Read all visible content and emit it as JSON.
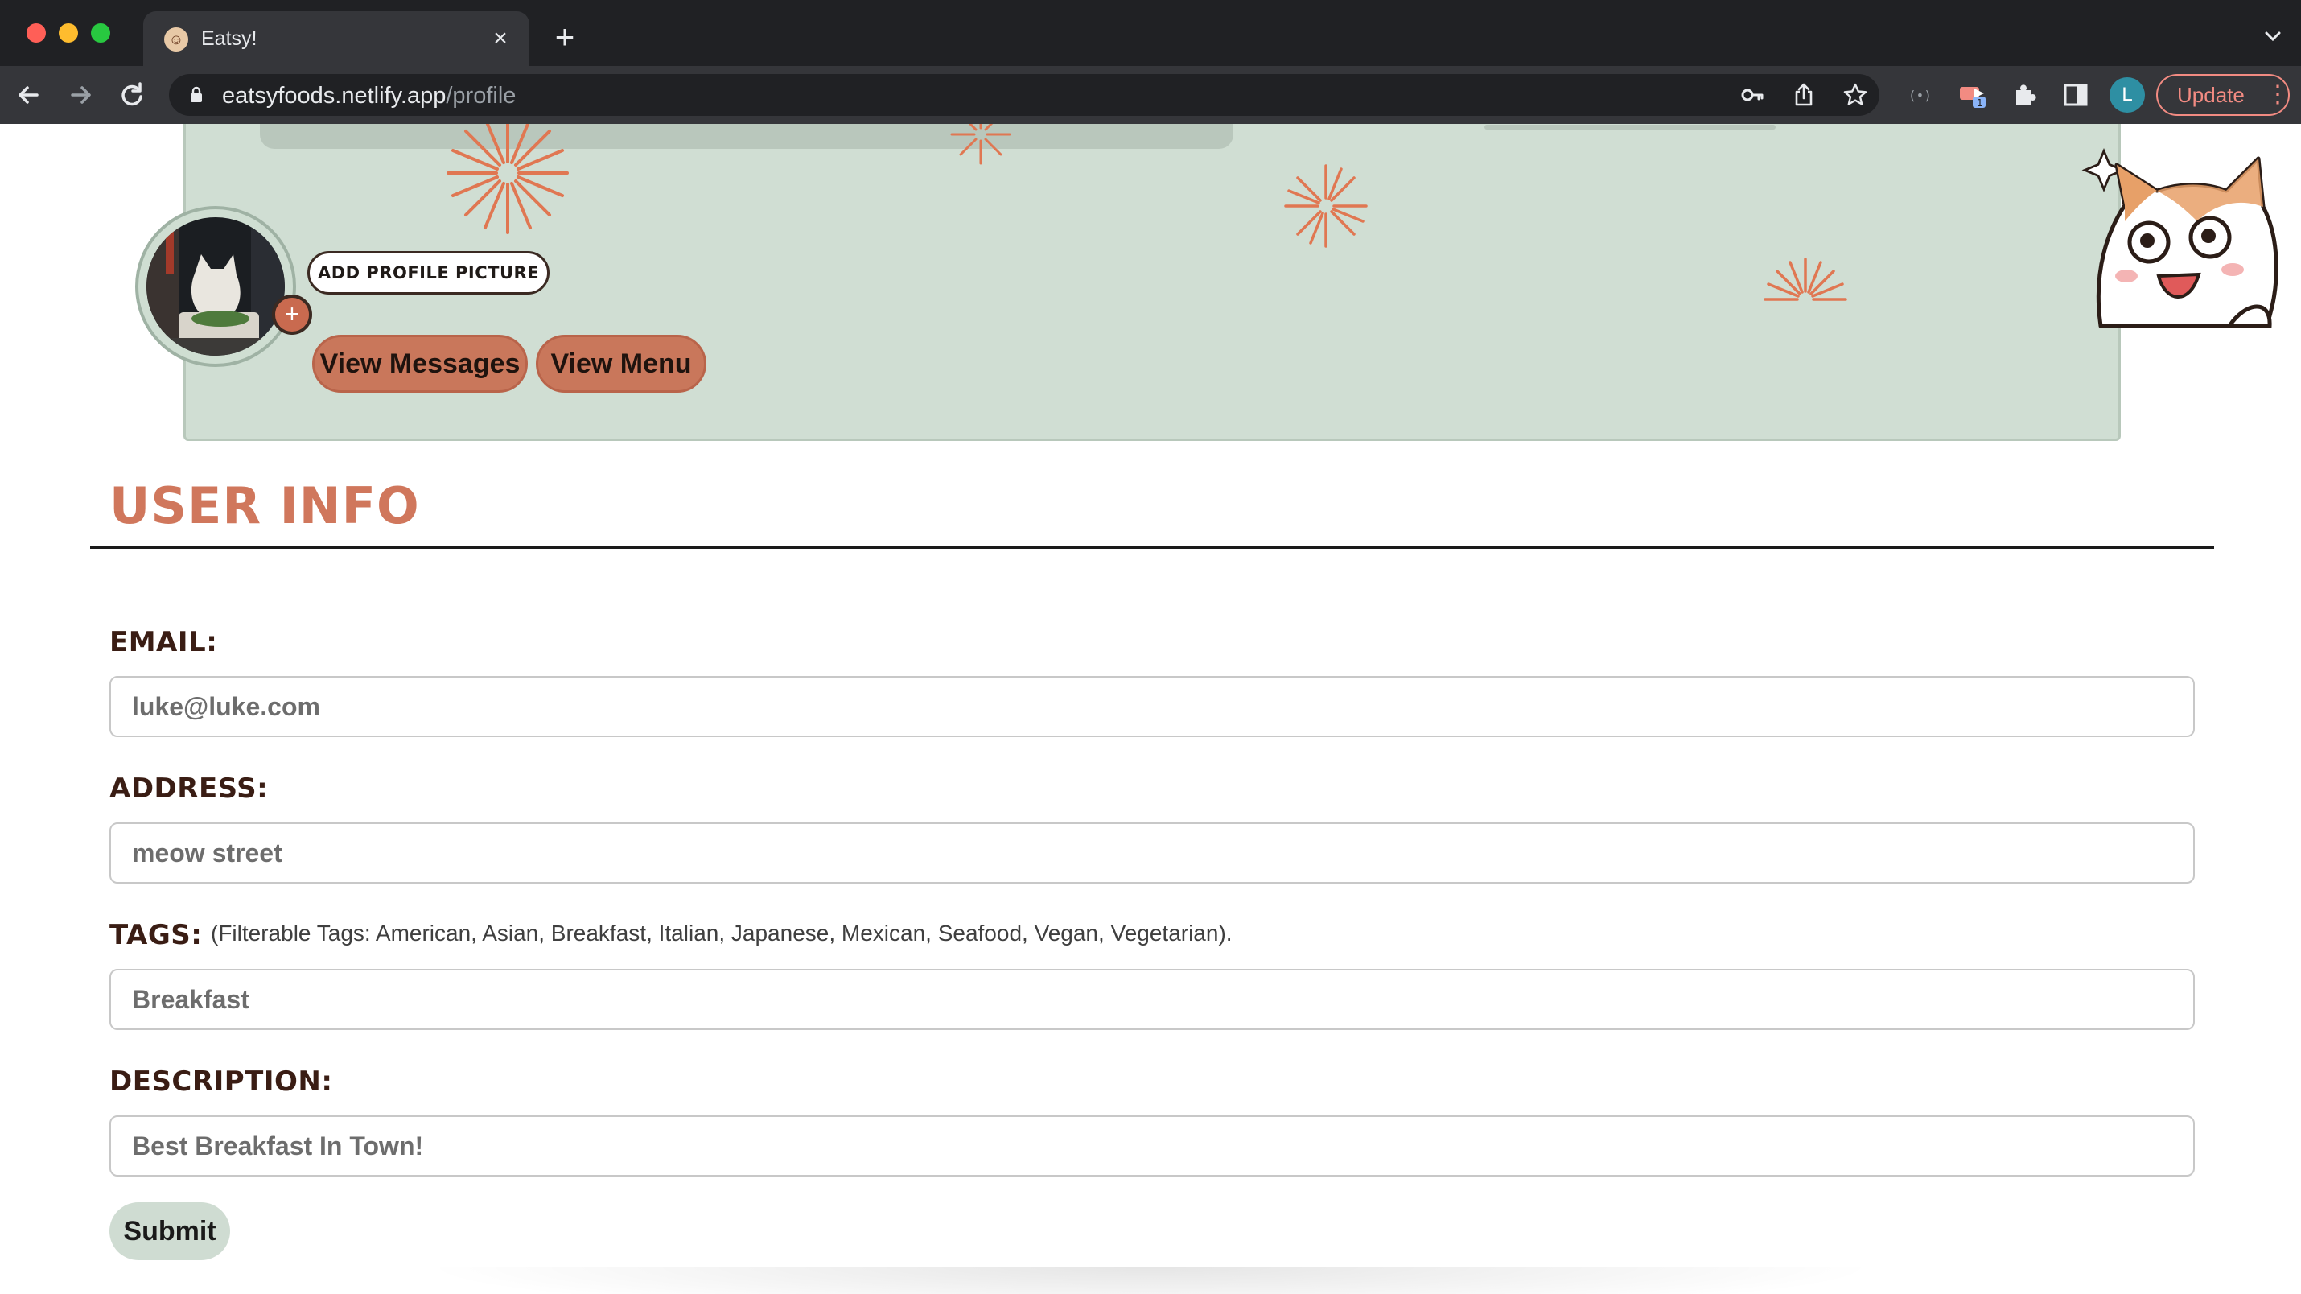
{
  "browser": {
    "tab_title": "Eatsy!",
    "tab_close_glyph": "×",
    "new_tab_glyph": "+",
    "url_host": "eatsyfoods.netlify.app",
    "url_path": "/profile",
    "profile_initial": "L",
    "update_label": "Update",
    "extension_badge": "1",
    "icons": [
      "back-icon",
      "forward-icon",
      "reload-icon",
      "lock-icon",
      "key-icon",
      "share-icon",
      "star-icon",
      "media-icon",
      "cast-extension-icon",
      "puzzle-icon",
      "sidebar-icon",
      "kebab-menu-icon"
    ]
  },
  "profile": {
    "add_picture_label": "ADD PROFILE PICTURE",
    "add_picture_plus": "+",
    "view_messages_label": "View Messages",
    "view_menu_label": "View Menu"
  },
  "user_info": {
    "title": "USER INFO",
    "email_label": "EMAIL:",
    "email_value": "luke@luke.com",
    "address_label": "ADDRESS:",
    "address_value": "meow street",
    "tags_label": "TAGS:",
    "tags_hint": "(Filterable Tags: American, Asian, Breakfast, Italian, Japanese, Mexican, Seafood, Vegan, Vegetarian).",
    "tags_value": "Breakfast",
    "description_label": "DESCRIPTION:",
    "description_value": "Best Breakfast In Town!",
    "submit_label": "Submit"
  },
  "colors": {
    "accent": "#c9775b",
    "title": "#d0775c",
    "label": "#3a1d14",
    "banner": "#d0ded3",
    "submit_bg": "#cfdcd2"
  }
}
